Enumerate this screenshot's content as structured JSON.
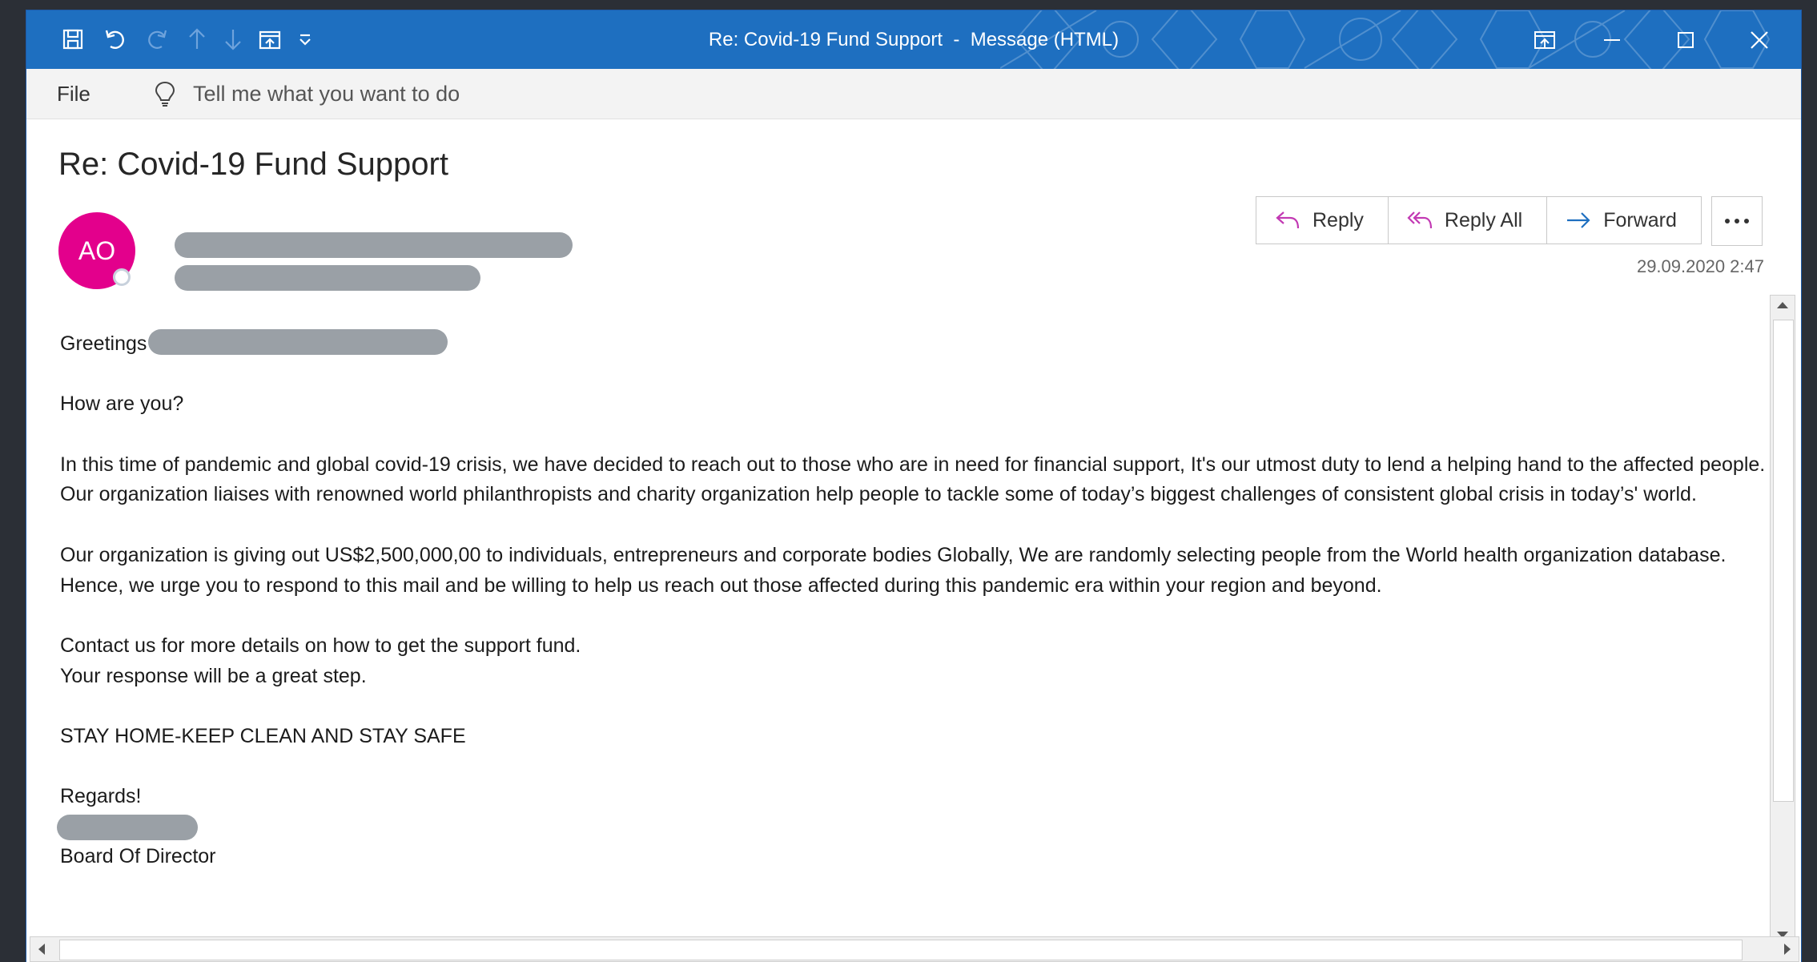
{
  "window": {
    "title": "Re: Covid-19 Fund Support  -  Message (HTML)",
    "titlebar_color": "#1e6fc0"
  },
  "quick_access": {
    "icons": [
      "save-icon",
      "undo-icon",
      "redo-icon",
      "previous-item-icon",
      "next-item-icon",
      "read-mode-icon",
      "customize-toolbar-icon"
    ]
  },
  "window_controls": {
    "icons": [
      "ribbon-display-options-icon",
      "minimize-icon",
      "maximize-icon",
      "close-icon"
    ]
  },
  "ribbon": {
    "file_tab": "File",
    "tell_me": "Tell me what you want to do"
  },
  "message": {
    "subject": "Re: Covid-19 Fund Support",
    "avatar_initials": "AO",
    "avatar_color": "#e3008c",
    "timestamp": "29.09.2020 2:47",
    "actions": {
      "reply": "Reply",
      "reply_all": "Reply All",
      "forward": "Forward",
      "accent_color": "#c239b3"
    },
    "body": {
      "greeting": "Greetings",
      "question": "How are you?",
      "paragraph1": "In this time of pandemic and global covid-19 crisis, we have decided to reach out to those who are in need for financial support, It's our utmost duty to lend a helping hand to the affected people. Our organization liaises with renowned world philanthropists and charity organization help people to tackle some of today’s biggest challenges of consistent global crisis in today’s' world.",
      "paragraph2": "Our organization is giving out US$2,500,000,00 to individuals, entrepreneurs and corporate bodies Globally, We are randomly selecting people from the World health organization database. Hence, we urge you to respond to this mail and be willing to help us reach out those affected during this pandemic era within your region and beyond.",
      "contact_line1": "Contact us for more details on how to get the support fund.",
      "contact_line2": "Your response will be a great step.",
      "slogan": "STAY HOME-KEEP CLEAN AND STAY SAFE",
      "closing": "Regards!",
      "signature_title": "Board Of Director"
    }
  }
}
